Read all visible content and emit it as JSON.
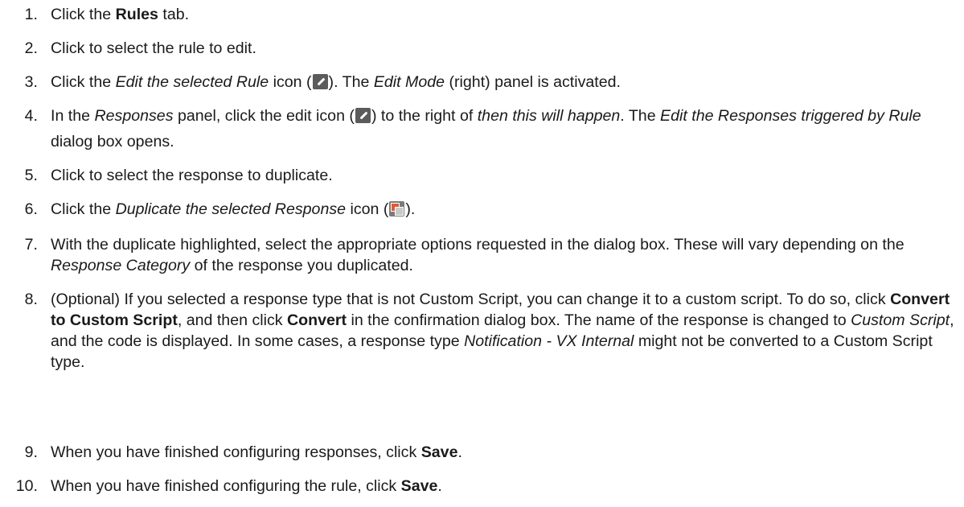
{
  "steps": [
    {
      "n": "1.",
      "a": "Click the ",
      "b": "Rules",
      "c": " tab."
    },
    {
      "n": "2.",
      "a": "Click to select the rule to edit."
    },
    {
      "n": "3.",
      "a": "Click the ",
      "b": "Edit the selected Rule",
      "c": " icon (",
      "d": "). The ",
      "e": "Edit Mode",
      "f": " (right) panel is activated.",
      "icon": "edit-pencil-icon"
    },
    {
      "n": "4.",
      "a": "In the ",
      "b": "Responses",
      "c": " panel, click the edit icon (",
      "d": ") to the right of ",
      "e": "then this will happen",
      "f": ". The ",
      "g": "Edit the Responses triggered by Rule",
      "h": " dialog box opens.",
      "icon": "edit-pencil-icon"
    },
    {
      "n": "5.",
      "a": "Click to select the response to duplicate."
    },
    {
      "n": "6.",
      "a": "Click the ",
      "b": "Duplicate the selected Response",
      "c": " icon (",
      "d": ").",
      "icon": "duplicate-icon"
    },
    {
      "n": "7.",
      "a": "With the duplicate highlighted, select the appropriate options requested in the dialog box. These will vary depending on the ",
      "b": "Response Category",
      "c": " of the response you duplicated."
    },
    {
      "n": "8.",
      "a": "(Optional) If you selected a response type that is not Custom Script, you can change it to a custom script. To do so, click ",
      "b": "Convert to Custom Script",
      "c": ", and then click ",
      "d": "Convert",
      "e": " in the confirmation dialog box. The name of the response is changed to ",
      "f": "Custom Script",
      "g": ", and the code is displayed. In some cases, a response type ",
      "h": "Notification - VX Internal",
      "i": " might not be converted to a Custom Script type."
    },
    {
      "n": "9.",
      "a": "When you have finished configuring responses, click ",
      "b": "Save",
      "c": "."
    },
    {
      "n": "10.",
      "a": "When you have finished configuring the rule, click ",
      "b": "Save",
      "c": "."
    }
  ]
}
